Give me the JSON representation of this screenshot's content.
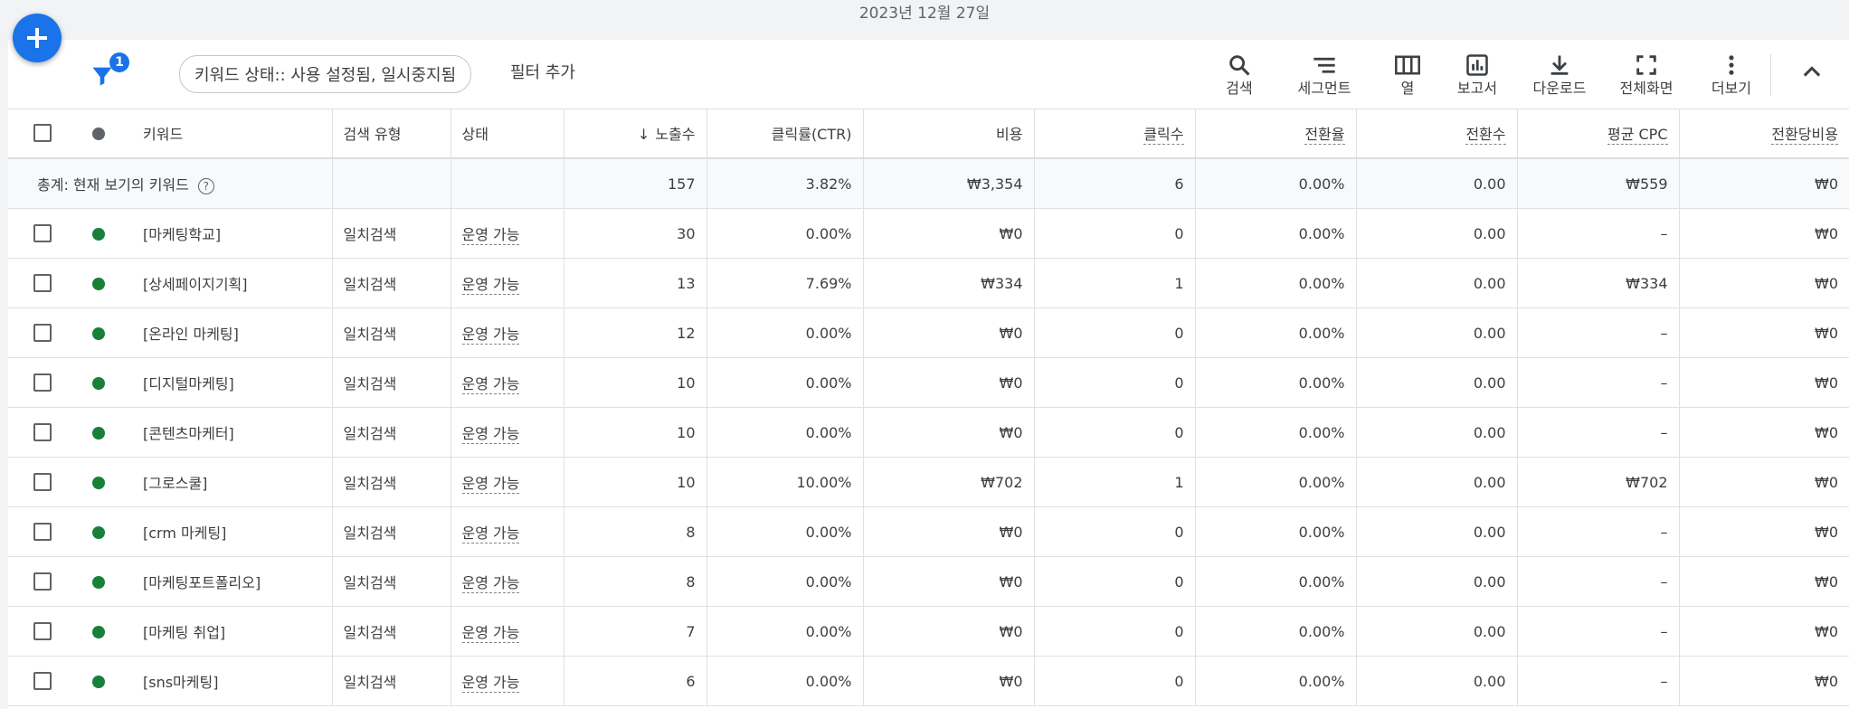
{
  "date": "2023년 12월 27일",
  "filter_count": "1",
  "filter_chip": "키워드 상태:: 사용 설정됨, 일시중지됨",
  "add_filter": "필터 추가",
  "toolbar": {
    "search": "검색",
    "segment": "세그먼트",
    "columns": "열",
    "report": "보고서",
    "download": "다운로드",
    "fullscreen": "전체화면",
    "more": "더보기"
  },
  "columns": {
    "keyword": "키워드",
    "match_type": "검색 유형",
    "status": "상태",
    "impressions": "노출수",
    "ctr": "클릭률(CTR)",
    "cost": "비용",
    "clicks": "클릭수",
    "conv_rate": "전환율",
    "conversions": "전환수",
    "avg_cpc": "평균 CPC",
    "cost_per_conv": "전환당비용"
  },
  "total": {
    "label": "총계: 현재 보기의 키워드",
    "impressions": "157",
    "ctr": "3.82%",
    "cost": "₩3,354",
    "clicks": "6",
    "conv_rate": "0.00%",
    "conversions": "0.00",
    "avg_cpc": "₩559",
    "cost_per_conv": "₩0"
  },
  "rows": [
    {
      "keyword": "[마케팅학교]",
      "match_type": "일치검색",
      "status": "운영 가능",
      "impressions": "30",
      "ctr": "0.00%",
      "cost": "₩0",
      "clicks": "0",
      "conv_rate": "0.00%",
      "conversions": "0.00",
      "avg_cpc": "–",
      "cost_per_conv": "₩0"
    },
    {
      "keyword": "[상세페이지기획]",
      "match_type": "일치검색",
      "status": "운영 가능",
      "impressions": "13",
      "ctr": "7.69%",
      "cost": "₩334",
      "clicks": "1",
      "conv_rate": "0.00%",
      "conversions": "0.00",
      "avg_cpc": "₩334",
      "cost_per_conv": "₩0"
    },
    {
      "keyword": "[온라인 마케팅]",
      "match_type": "일치검색",
      "status": "운영 가능",
      "impressions": "12",
      "ctr": "0.00%",
      "cost": "₩0",
      "clicks": "0",
      "conv_rate": "0.00%",
      "conversions": "0.00",
      "avg_cpc": "–",
      "cost_per_conv": "₩0"
    },
    {
      "keyword": "[디지털마케팅]",
      "match_type": "일치검색",
      "status": "운영 가능",
      "impressions": "10",
      "ctr": "0.00%",
      "cost": "₩0",
      "clicks": "0",
      "conv_rate": "0.00%",
      "conversions": "0.00",
      "avg_cpc": "–",
      "cost_per_conv": "₩0"
    },
    {
      "keyword": "[콘텐츠마케터]",
      "match_type": "일치검색",
      "status": "운영 가능",
      "impressions": "10",
      "ctr": "0.00%",
      "cost": "₩0",
      "clicks": "0",
      "conv_rate": "0.00%",
      "conversions": "0.00",
      "avg_cpc": "–",
      "cost_per_conv": "₩0"
    },
    {
      "keyword": "[그로스쿨]",
      "match_type": "일치검색",
      "status": "운영 가능",
      "impressions": "10",
      "ctr": "10.00%",
      "cost": "₩702",
      "clicks": "1",
      "conv_rate": "0.00%",
      "conversions": "0.00",
      "avg_cpc": "₩702",
      "cost_per_conv": "₩0"
    },
    {
      "keyword": "[crm 마케팅]",
      "match_type": "일치검색",
      "status": "운영 가능",
      "impressions": "8",
      "ctr": "0.00%",
      "cost": "₩0",
      "clicks": "0",
      "conv_rate": "0.00%",
      "conversions": "0.00",
      "avg_cpc": "–",
      "cost_per_conv": "₩0"
    },
    {
      "keyword": "[마케팅포트폴리오]",
      "match_type": "일치검색",
      "status": "운영 가능",
      "impressions": "8",
      "ctr": "0.00%",
      "cost": "₩0",
      "clicks": "0",
      "conv_rate": "0.00%",
      "conversions": "0.00",
      "avg_cpc": "–",
      "cost_per_conv": "₩0"
    },
    {
      "keyword": "[마케팅 취업]",
      "match_type": "일치검색",
      "status": "운영 가능",
      "impressions": "7",
      "ctr": "0.00%",
      "cost": "₩0",
      "clicks": "0",
      "conv_rate": "0.00%",
      "conversions": "0.00",
      "avg_cpc": "–",
      "cost_per_conv": "₩0"
    },
    {
      "keyword": "[sns마케팅]",
      "match_type": "일치검색",
      "status": "운영 가능",
      "impressions": "6",
      "ctr": "0.00%",
      "cost": "₩0",
      "clicks": "0",
      "conv_rate": "0.00%",
      "conversions": "0.00",
      "avg_cpc": "–",
      "cost_per_conv": "₩0"
    }
  ],
  "colors": {
    "accent": "#1a73e8",
    "enabled_dot": "#188038",
    "header_dot": "#5f6368"
  }
}
